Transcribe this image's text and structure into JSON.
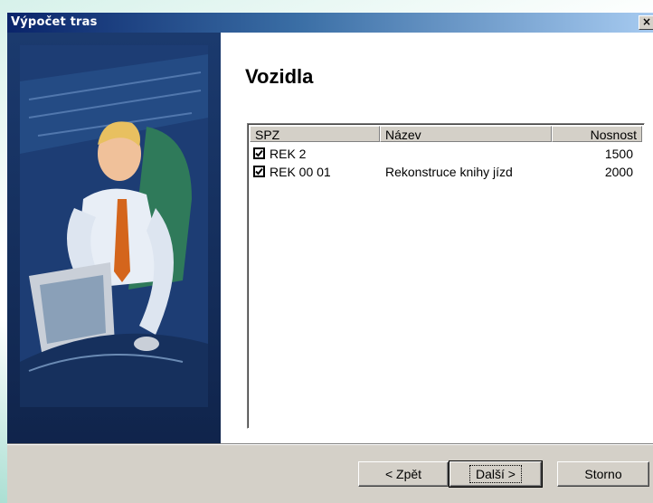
{
  "window": {
    "title": "Výpočet tras",
    "close_glyph": "×"
  },
  "page": {
    "heading": "Vozidla"
  },
  "vehicles_table": {
    "columns": [
      "SPZ",
      "Název",
      "Nosnost"
    ],
    "rows": [
      {
        "checked": true,
        "spz": "REK 2",
        "nazev": "",
        "nosnost": "1500"
      },
      {
        "checked": true,
        "spz": "REK 00 01",
        "nazev": "Rekonstruce knihy jízd",
        "nosnost": "2000"
      }
    ]
  },
  "buttons": {
    "back": "< Zpět",
    "next": "Další >",
    "cancel": "Storno"
  },
  "colors": {
    "titlebar_start": "#0a246a",
    "titlebar_end": "#a6caf0",
    "dialog_face": "#d4d0c8",
    "side_panel": "#1b3a6e"
  },
  "icons": {
    "close": "close-icon",
    "checkbox": "checkbox-checked-icon",
    "illustration": "man-at-computer-illustration"
  }
}
